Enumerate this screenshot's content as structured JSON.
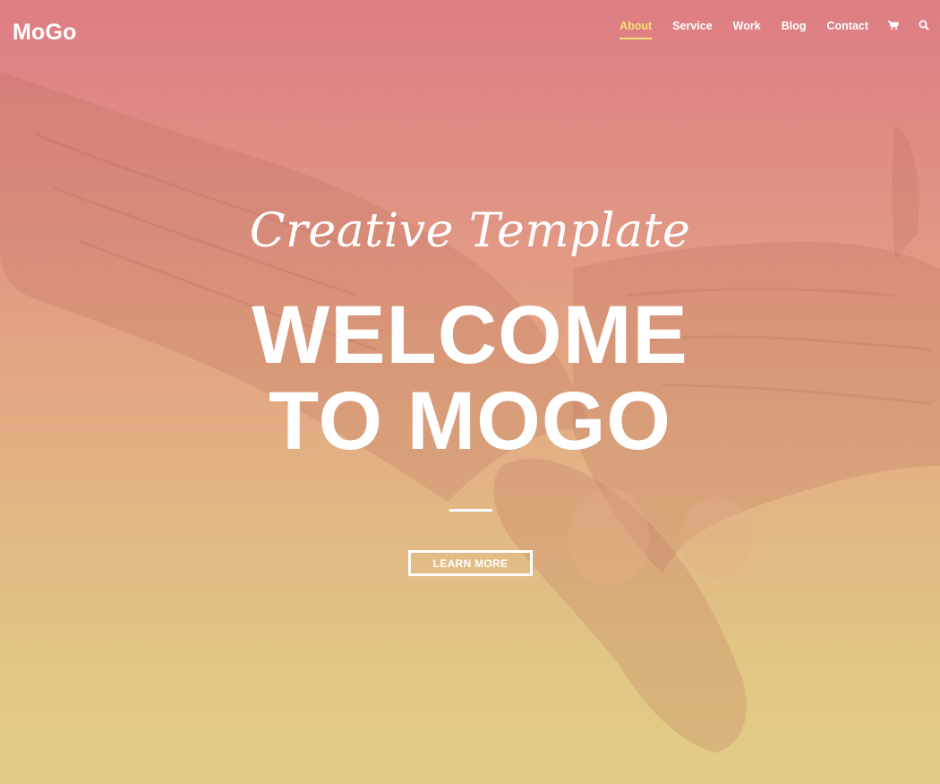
{
  "brand": {
    "logo_text": "MoGo"
  },
  "nav": {
    "items": [
      {
        "label": "About",
        "active": true
      },
      {
        "label": "Service",
        "active": false
      },
      {
        "label": "Work",
        "active": false
      },
      {
        "label": "Blog",
        "active": false
      },
      {
        "label": "Contact",
        "active": false
      }
    ],
    "icons": [
      "cart-icon",
      "search-icon"
    ]
  },
  "hero": {
    "tagline": "Creative Template",
    "title_line1": "WELCOME",
    "title_line2": "TO MOGO",
    "cta_label": "LEARN MORE"
  },
  "colors": {
    "active_accent": "#f5e072",
    "gradient_top": "#de7d83",
    "gradient_bottom": "#e2cd88",
    "text": "#ffffff"
  }
}
